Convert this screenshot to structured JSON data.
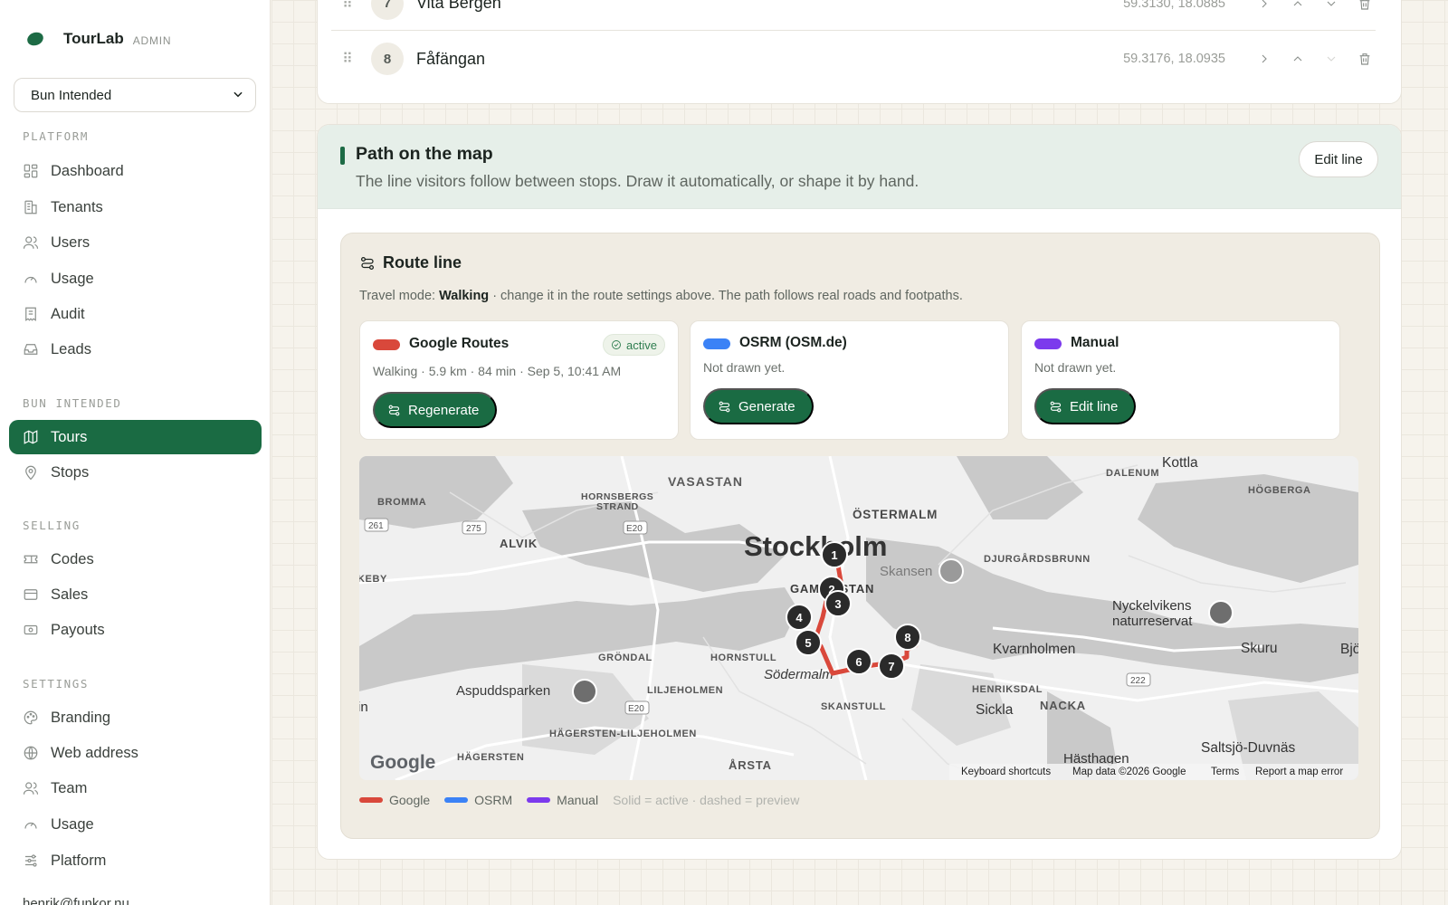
{
  "brand": {
    "name": "TourLab",
    "badge": "ADMIN"
  },
  "tenant_select": {
    "value": "Bun Intended"
  },
  "nav": {
    "section_platform": "PLATFORM",
    "section_bun": "BUN INTENDED",
    "section_selling": "SELLING",
    "section_settings": "SETTINGS",
    "items": [
      {
        "label": "Dashboard",
        "icon": "dashboard-icon"
      },
      {
        "label": "Tenants",
        "icon": "building-icon"
      },
      {
        "label": "Users",
        "icon": "users-icon"
      },
      {
        "label": "Usage",
        "icon": "gauge-icon"
      },
      {
        "label": "Audit",
        "icon": "receipt-icon"
      },
      {
        "label": "Leads",
        "icon": "inbox-icon"
      },
      {
        "label": "Tours",
        "icon": "map-icon",
        "active": true
      },
      {
        "label": "Stops",
        "icon": "pin-icon"
      },
      {
        "label": "Codes",
        "icon": "ticket-icon"
      },
      {
        "label": "Sales",
        "icon": "card-icon"
      },
      {
        "label": "Payouts",
        "icon": "banknote-icon"
      },
      {
        "label": "Branding",
        "icon": "palette-icon"
      },
      {
        "label": "Web address",
        "icon": "globe-icon"
      },
      {
        "label": "Team",
        "icon": "team-icon"
      },
      {
        "label": "Usage",
        "icon": "gauge-icon"
      },
      {
        "label": "Platform",
        "icon": "sliders-icon"
      }
    ],
    "user_email": "henrik@funkor.nu"
  },
  "stops": [
    {
      "num": "7",
      "name": "Vita Bergen",
      "coords": "59.3130, 18.0885"
    },
    {
      "num": "8",
      "name": "Fåfängan",
      "coords": "59.3176, 18.0935"
    }
  ],
  "path_section": {
    "title": "Path on the map",
    "subtitle": "The line visitors follow between stops. Draw it automatically, or shape it by hand.",
    "edit_button": "Edit line"
  },
  "route_line": {
    "title": "Route line",
    "travel_prefix": "Travel mode:",
    "travel_mode": "Walking",
    "travel_suffix": "· change it in the route settings above. The path follows real roads and footpaths.",
    "providers": [
      {
        "name": "Google Routes",
        "color": "#d9483b",
        "meta": "Walking · 5.9 km · 84 min · Sep 5, 10:41 AM",
        "button": "Regenerate",
        "badge": "active"
      },
      {
        "name": "OSRM (OSM.de)",
        "color": "#3b82f6",
        "meta": "Not drawn yet.",
        "button": "Generate"
      },
      {
        "name": "Manual",
        "color": "#7c3aed",
        "meta": "Not drawn yet.",
        "button": "Edit line"
      }
    ]
  },
  "map": {
    "city": "Stockholm",
    "places": [
      "VASASTAN",
      "HORNSBERGS STRAND",
      "BROMMA",
      "ALVIK",
      "ÖSTERMALM",
      "Skansen",
      "DJURGÅRDSBRUNN",
      "GAMLA STAN",
      "Södermalm",
      "HORNSTULL",
      "GRÖNDAL",
      "LILJEHOLMEN",
      "Aspuddsparken",
      "HÄGERSTEN-LILJEHOLMEN",
      "HÄGERSTEN",
      "SKANSTULL",
      "ÅRSTA",
      "HENRIKSDAL",
      "Sickla",
      "NACKA",
      "Kvarnholmen",
      "Nyckelvikens naturreservat",
      "Skuru",
      "Kottla",
      "DALENUM",
      "HÖGBERGA",
      "Saltsjö-Duvnäs",
      "Hästhagen",
      "KEBY",
      "in",
      "Bjö"
    ],
    "roads": [
      "261",
      "275",
      "E20",
      "E20",
      "222"
    ],
    "markers": [
      "1",
      "2",
      "3",
      "4",
      "5",
      "6",
      "7",
      "8"
    ],
    "attribution": {
      "logo": "Google",
      "shortcuts": "Keyboard shortcuts",
      "data": "Map data ©2026 Google",
      "terms": "Terms",
      "report": "Report a map error"
    }
  },
  "legend": {
    "items": [
      {
        "label": "Google",
        "color": "#d9483b"
      },
      {
        "label": "OSRM",
        "color": "#3b82f6"
      },
      {
        "label": "Manual",
        "color": "#7c3aed"
      }
    ],
    "note": "Solid = active · dashed = preview"
  }
}
